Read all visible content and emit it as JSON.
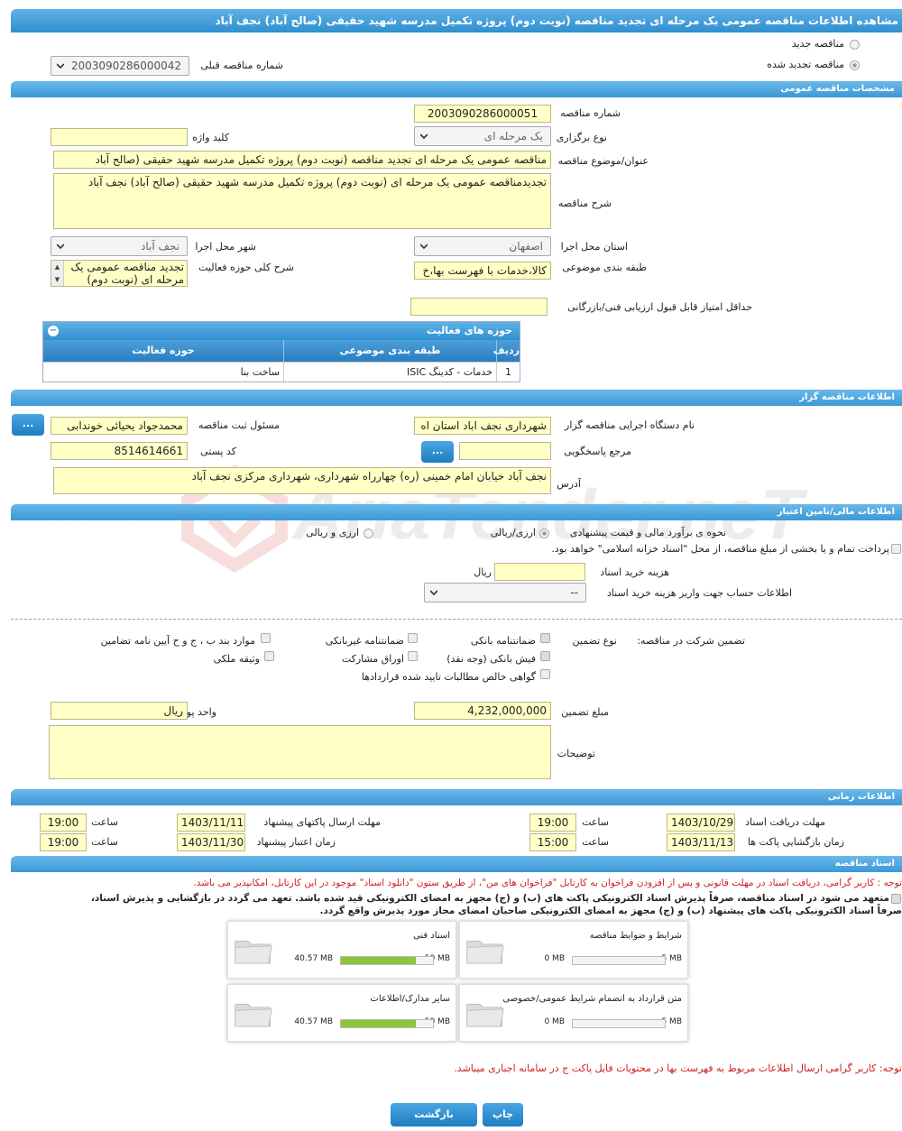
{
  "title": "مشاهده اطلاعات مناقصه عمومی یک مرحله ای تجدید مناقصه (نوبت دوم) پروژه تکمیل مدرسه شهید حقیقی (صالح آباد) نجف آباد",
  "tender_type": {
    "new_label": "مناقصه جدید",
    "renewed_label": "مناقصه تجدید شده",
    "prev_number_label": "شماره مناقصه قبلی",
    "prev_number": "2003090286000042"
  },
  "general": {
    "header": "مشخصات مناقصه عمومی",
    "number_label": "شماره مناقصه",
    "number": "2003090286000051",
    "holding_type_label": "نوع برگزاری",
    "holding_type": "یک مرحله ای",
    "keyword_label": "کلید واژه",
    "keyword": "",
    "subject_label": "عنوان/موضوع مناقصه",
    "subject": "مناقصه عمومی یک مرحله ای تجدید مناقصه (نوبت دوم) پروژه تکمیل مدرسه شهید حقیقی (صالح آباد",
    "description_label": "شرح مناقصه",
    "description": "تجدیدمناقصه عمومی یک مرحله ای (نوبت دوم) پروژه تکمیل مدرسه شهید حقیقی (صالح آباد) نجف آباد",
    "province_label": "استان محل اجرا",
    "province": "اصفهان",
    "city_label": "شهر محل اجرا",
    "city": "نجف آباد",
    "category_label": "طبقه بندی موضوعی",
    "category": "کالا،خدمات با فهرست بها،خ",
    "activity_desc_label": "شرح کلی حوزه فعالیت",
    "activity_desc": "تجدید مناقصه عمومی یک مرحله ای (نوبت دوم) پروژه",
    "min_score_label": "حداقل امتیاز قابل قبول ارزیابی فنی/بازرگانی",
    "min_score": ""
  },
  "activity_table": {
    "title": "حوزه های فعالیت",
    "headers": [
      "ردیف",
      "طبقه بندی موضوعی",
      "حوزه فعالیت"
    ],
    "rows": [
      [
        "1",
        "خدمات - کدینگ ISIC",
        "ساخت بنا"
      ]
    ]
  },
  "organizer": {
    "header": "اطلاعات مناقصه گزار",
    "org_label": "نام دستگاه اجرایی مناقصه گزار",
    "org": "شهرداری نجف اباد استان اه",
    "registrar_label": "مسئول ثبت مناقصه",
    "registrar": "محمدجواد یحیائی خوندابی",
    "ref_label": "مرجع پاسخگویی",
    "ref": "",
    "postal_label": "کد پستی",
    "postal": "8514614661",
    "address_label": "آدرس",
    "address": "نجف آباد خیابان امام خمینی (ره) چهارراه شهرداری، شهرداری مرکزی نجف آباد",
    "more_btn": "..."
  },
  "financial": {
    "header": "اطلاعات مالی/تامین اعتبار",
    "estimate_label": "نحوه ی برآورد مالی و قیمت پیشنهادی",
    "opt_rial_currency": "ارزی/ریالی",
    "opt_currency_rial": "ارزی و ریالی",
    "treasury_note": "پرداخت تمام و یا بخشی از مبلغ مناقصه، از محل \"اسناد خزانه اسلامی\" خواهد بود.",
    "doc_cost_label": "هزینه خرید اسناد",
    "doc_cost": "",
    "doc_cost_unit": "ریال",
    "account_label": "اطلاعات حساب جهت واریز هزینه خرید اسناد",
    "account": "--"
  },
  "guarantee": {
    "label": "تضمین شرکت در مناقصه:",
    "type_label": "نوع تضمین",
    "bank_guarantee": "ضمانتنامه بانکی",
    "nonbank_guarantee": "ضمانتنامه غیربانکی",
    "rules_items": "موارد بند ب ، ج و ح آیین نامه تضامین",
    "bank_receipt": "فیش بانکی (وجه نقد)",
    "bonds": "اوراق مشارکت",
    "property": "وثیقه ملکی",
    "net_claims": "گواهی خالص مطالبات تایید شده قراردادها",
    "amount_label": "مبلغ تضمین",
    "amount": "4,232,000,000",
    "currency_label": "واحد پول",
    "currency": "ریال",
    "notes_label": "توضیحات",
    "notes": ""
  },
  "timing": {
    "header": "اطلاعات زمانی",
    "doc_receive_label": "مهلت دریافت اسناد",
    "doc_receive_date": "1403/10/29",
    "doc_receive_time": "19:00",
    "submit_label": "مهلت ارسال پاکتهای پیشنهاد",
    "submit_date": "1403/11/11",
    "submit_time": "19:00",
    "opening_label": "زمان بازگشایی پاکت ها",
    "opening_date": "1403/11/13",
    "opening_time": "15:00",
    "validity_label": "زمان اعتبار پیشنهاد",
    "validity_date": "1403/11/30",
    "validity_time": "19:00",
    "time_label": "ساعت"
  },
  "documents": {
    "header": "اسناد مناقصه",
    "note1": "توجه : کاربر گرامی، دریافت اسناد در مهلت قانونی و پس از افزودن فراخوان به کارتابل \"فراخوان های من\"، از طریق ستون \"دانلود اسناد\" موجود در این کارتابل، امکانپذیر می باشد.",
    "pledge1": "متعهد می شود در اسناد مناقصه، صرفاً پذیرش اسناد الکترونیکی پاکت های (ب) و (ج) مجهز به امضای الکترونیکی قید شده باشد. تعهد می گردد در بازگشایی و پذیرش اسناد،",
    "pledge2": "صرفاً اسناد الکترونیکی پاکت های پیشنهاد (ب) و (ج) مجهز به امضای الکترونیکی صاحبان امضای مجاز مورد پذیرش واقع گردد.",
    "cards": [
      {
        "name": "شرایط و ضوابط مناقصه",
        "max": "5 MB",
        "used": "0 MB",
        "fill": 0
      },
      {
        "name": "اسناد فنی",
        "max": "50 MB",
        "used": "40.57 MB",
        "fill": 0.81
      },
      {
        "name": "متن قرارداد به انضمام شرایط عمومی/خصوصی",
        "max": "5 MB",
        "used": "0 MB",
        "fill": 0
      },
      {
        "name": "سایر مدارک/اطلاعات",
        "max": "50 MB",
        "used": "40.57 MB",
        "fill": 0.81
      }
    ],
    "note2": "توجه: کاربر گرامی ارسال اطلاعات مربوط به فهرست بها در محتویات فایل پاکت ج در سامانه اجباری میباشد."
  },
  "footer": {
    "back": "بازگشت",
    "print": "چاپ"
  },
  "watermark": "AriaTender.neT",
  "colors": {
    "header": "#3c98d6",
    "input": "#ffffc6",
    "red_note": "#d02020",
    "progress": "#8cc43c"
  }
}
